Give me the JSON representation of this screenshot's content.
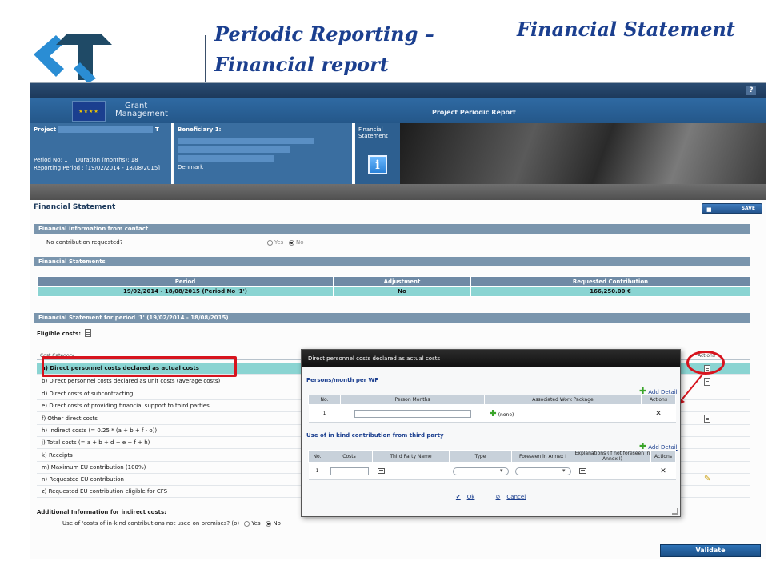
{
  "slide": {
    "title_line1": "Periodic Reporting –",
    "title_line2": "Financial report",
    "subject": "Financial Statement",
    "colors": {
      "title": "#1b3f8f",
      "logo_dark": "#1f4a66",
      "logo_light": "#2a8dd4"
    }
  },
  "app": {
    "help_label": "?",
    "brand_line1": "Grant",
    "brand_line2": "Management",
    "window_title": "Project Periodic Report",
    "project": {
      "label": "Project",
      "code_suffix": "T",
      "period_no": "Period No: 1",
      "duration": "Duration (months): 18",
      "reporting_period": "Reporting Period : [19/02/2014 - 18/08/2015]"
    },
    "beneficiary": {
      "label": "Beneficiary 1:",
      "country": "Denmark"
    },
    "financial_statement_tile": {
      "line1": "Financial",
      "line2": "Statement",
      "icon": "info-icon"
    },
    "heading": "Financial Statement",
    "save_label": "SAVE",
    "sections": {
      "contact": "Financial information from contact",
      "statements": "Financial Statements",
      "period": "Financial Statement for period '1' (19/02/2014 - 18/08/2015)"
    },
    "contribution_question": "No contribution requested?",
    "radio_yes": "Yes",
    "radio_no": "No",
    "statements_table": {
      "headers": [
        "Period",
        "Adjustment",
        "Requested Contribution"
      ],
      "row": [
        "19/02/2014 - 18/08/2015 (Period No '1')",
        "No",
        "166,250.00 €"
      ]
    },
    "eligible_costs_label": "Eligible costs:",
    "cost_table": {
      "header_category": "Cost Category",
      "header_actions": "Actions",
      "rows": [
        "a) Direct personnel costs declared as actual costs",
        "b) Direct personnel costs declared as unit costs (average costs)",
        "d) Direct costs of subcontracting",
        "e) Direct costs of providing financial support to third parties",
        "f) Other direct costs",
        "h) Indirect costs (= 0.25 * (a + b + f - o))",
        "j) Total costs (= a + b + d + e + f + h)",
        "k) Receipts",
        "m) Maximum EU contribution (100%)",
        "n) Requested EU contribution",
        "z) Requested EU contribution eligible for CFS"
      ]
    },
    "additional_info": {
      "heading": "Additional Information for indirect costs:",
      "question": "Use of 'costs of in-kind contributions not used on premises? (o)",
      "yes": "Yes",
      "no": "No"
    },
    "validate_label": "Validate",
    "colors": {
      "highlight": "#8ad4d2",
      "section_bar": "#7a95ad",
      "annotation": "#d7141e"
    }
  },
  "modal": {
    "title": "Direct personnel costs declared as actual costs",
    "persons_section": "Persons/month per WP",
    "add_detail": "Add Detail",
    "persons_table": {
      "headers": [
        "No.",
        "Person Months",
        "Associated Work Package",
        "Actions"
      ],
      "row_no": "1",
      "work_package": "(none)"
    },
    "inkind_section": "Use of in kind contribution from third party",
    "inkind_table": {
      "headers": [
        "No.",
        "Costs",
        "Third Party Name",
        "Type",
        "Foreseen in Annex I",
        "Explanations (if not foreseen in Annex I)",
        "Actions"
      ],
      "row_no": "1"
    },
    "ok_label": "Ok",
    "cancel_label": "Cancel"
  }
}
